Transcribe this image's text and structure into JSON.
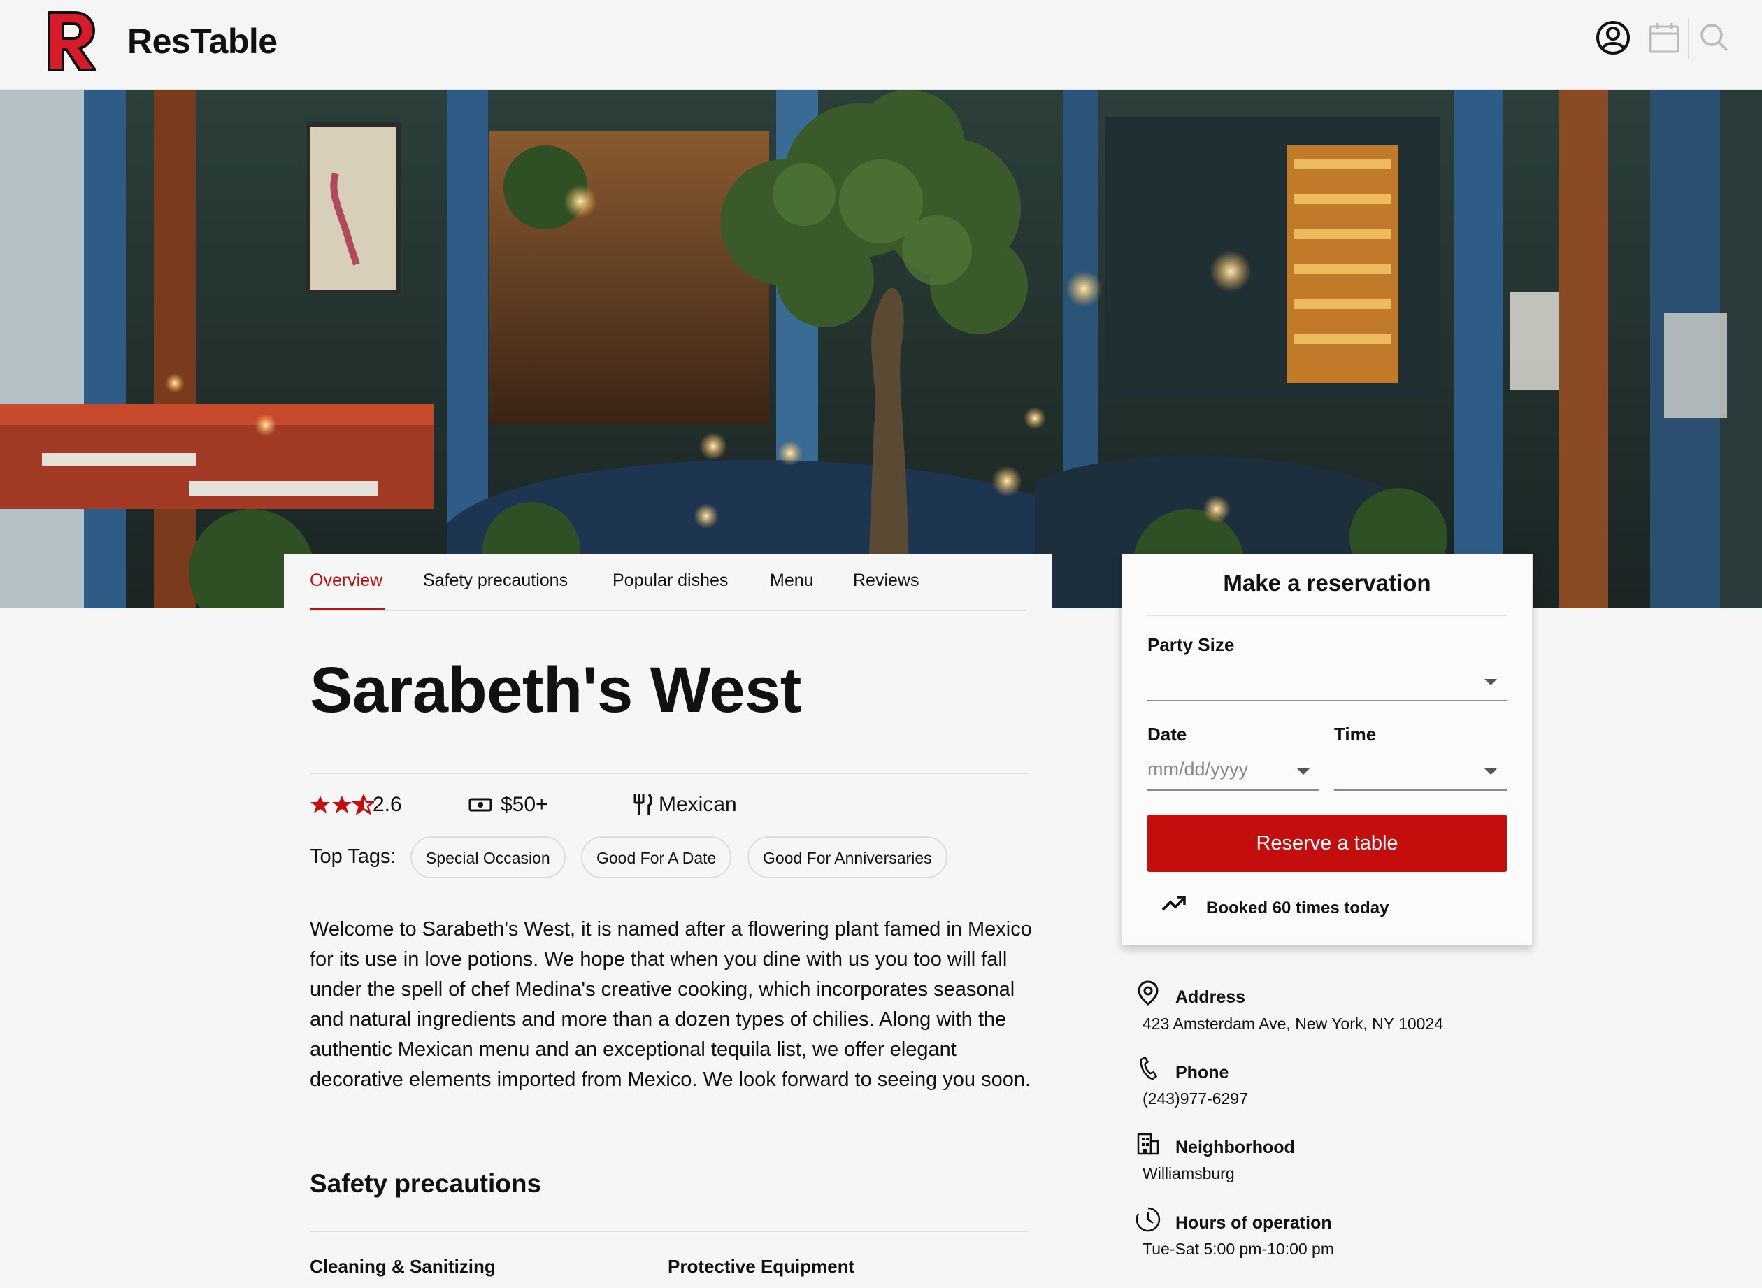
{
  "app": {
    "brand": "ResTable",
    "logo_letter": "R",
    "accent": "#c40d0d"
  },
  "header_icons": [
    "account-icon",
    "calendar-icon",
    "search-icon"
  ],
  "tabs": [
    {
      "label": "Overview",
      "active": true
    },
    {
      "label": "Safety precautions",
      "active": false
    },
    {
      "label": "Popular dishes",
      "active": false
    },
    {
      "label": "Menu",
      "active": false
    },
    {
      "label": "Reviews",
      "active": false
    }
  ],
  "restaurant": {
    "name": "Sarabeth's West",
    "rating": "2.6",
    "rating_value": 2.5,
    "price": "$50+",
    "cuisine": "Mexican",
    "tags_label": "Top Tags:",
    "tags": [
      "Special Occasion",
      "Good For A Date",
      "Good For Anniversaries"
    ],
    "description": "Welcome to Sarabeth's West, it is named after a flowering plant famed in Mexico for its use in love potions. We hope that when you dine with us you too will fall under the spell of chef Medina's creative cooking, which incorporates seasonal and natural ingredients and more than a dozen types of chilies. Along with the authentic Mexican menu and an exceptional tequila list, we offer elegant decorative elements imported from Mexico. We look forward to seeing you soon."
  },
  "safety": {
    "heading": "Safety precautions",
    "col1": "Cleaning & Sanitizing",
    "col2": "Protective Equipment"
  },
  "reservation": {
    "title": "Make a reservation",
    "party_label": "Party Size",
    "party_value": "",
    "date_label": "Date",
    "date_placeholder": "mm/dd/yyyy",
    "time_label": "Time",
    "time_value": "",
    "button": "Reserve a table",
    "booked": "Booked 60 times today"
  },
  "info": {
    "address_label": "Address",
    "address": "423 Amsterdam Ave, New York, NY 10024",
    "phone_label": "Phone",
    "phone": "(243)977-6297",
    "neighborhood_label": "Neighborhood",
    "neighborhood": "Williamsburg",
    "hours_label": "Hours of operation",
    "hours": "Tue-Sat 5:00 pm-10:00 pm"
  }
}
